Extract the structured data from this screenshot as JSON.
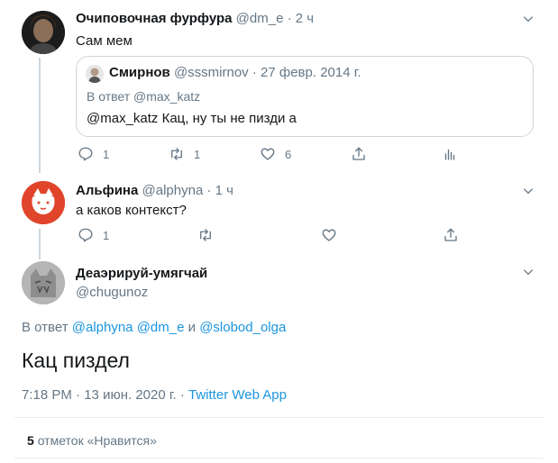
{
  "tweets": [
    {
      "author_name": "Очиповочная фурфура",
      "handle": "@dm_e",
      "sep": "·",
      "time": "2 ч",
      "text": "Сам мем",
      "quote": {
        "author_name": "Смирнов",
        "handle": "@sssmirnov",
        "sep": "·",
        "date": "27 февр. 2014 г.",
        "reply_to": "В ответ @max_katz",
        "text": "@max_katz Кац, ну ты не пизди а"
      },
      "actions": {
        "replies": "1",
        "retweets": "1",
        "likes": "6"
      }
    },
    {
      "author_name": "Альфина",
      "handle": "@alphyna",
      "sep": "·",
      "time": "1 ч",
      "text": "а каков контекст?",
      "actions": {
        "replies": "1"
      }
    }
  ],
  "main_tweet": {
    "author_name": "Деаэрируй-умягчай",
    "handle": "@chugunoz",
    "reply_prefix": "В ответ",
    "reply_user1": "@alphyna",
    "reply_user2": "@dm_e",
    "reply_and": "и",
    "reply_user3": "@slobod_olga",
    "text": "Кац пиздел",
    "time": "7:18 PM",
    "date": "13 июн. 2020 г.",
    "sep": "·",
    "source": "Twitter Web App",
    "likes_count": "5",
    "likes_label": "отметок «Нравится»"
  },
  "icons": [
    "chevron-down-icon",
    "reply-icon",
    "retweet-icon",
    "like-icon",
    "share-icon",
    "analytics-icon"
  ],
  "colors": {
    "link": "#1b95e0",
    "muted": "#657786",
    "border": "#ccd6dd"
  }
}
